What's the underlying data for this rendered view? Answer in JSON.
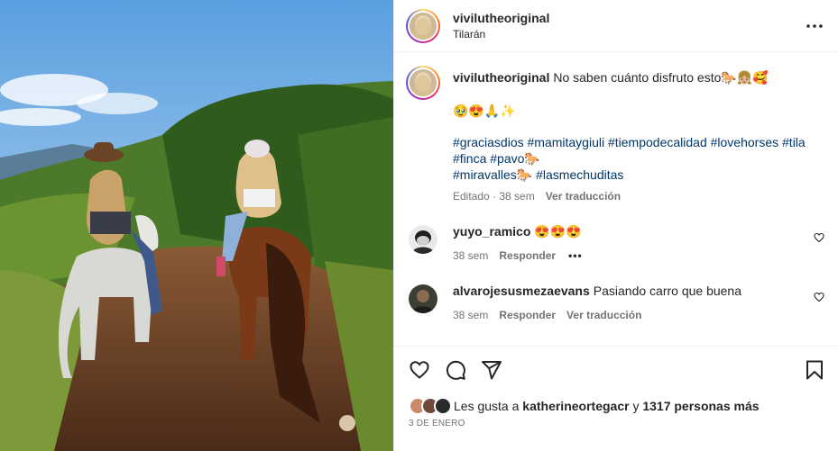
{
  "post": {
    "username": "vivilutheoriginal",
    "location": "Tilarán"
  },
  "caption": {
    "username": "vivilutheoriginal",
    "text": "No saben cuánto disfruto esto🐎👧🏼🥰",
    "emojis": "🥹😍🙏✨",
    "hashtags": [
      "#graciasdios",
      "#mamitaygiuli",
      "#tiempodecalidad",
      "#lovehorses",
      "#tila",
      "#finca",
      "#pavo🐎",
      "#miravalles🐎",
      "#lasmechuditas"
    ],
    "edited": "Editado · 38 sem",
    "translate": "Ver traducción"
  },
  "comments": [
    {
      "username": "yuyo_ramico",
      "text": "😍😍😍",
      "time": "38 sem",
      "reply": "Responder",
      "more": "•••"
    },
    {
      "username": "alvarojesusmezaevans",
      "text": "Pasiando carro que buena",
      "time": "38 sem",
      "reply": "Responder",
      "translate": "Ver traducción"
    }
  ],
  "likes": {
    "prefix": "Les gusta a",
    "user": "katherineortegacr",
    "connector": "y",
    "others": "1317 personas más"
  },
  "date": "3 DE ENERO",
  "icons": {
    "more": "more-horizontal-icon",
    "like": "heart-icon",
    "comment": "comment-icon",
    "share": "send-icon",
    "save": "bookmark-icon"
  }
}
